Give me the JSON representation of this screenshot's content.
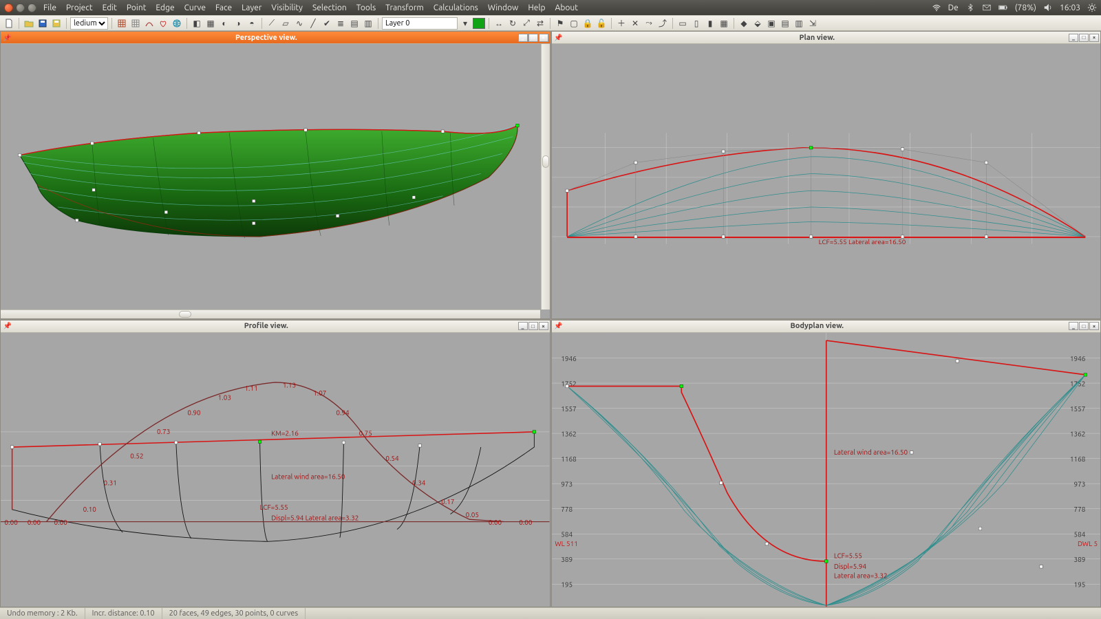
{
  "menubar": {
    "items": [
      "File",
      "Project",
      "Edit",
      "Point",
      "Edge",
      "Curve",
      "Face",
      "Layer",
      "Visibility",
      "Selection",
      "Tools",
      "Transform",
      "Calculations",
      "Window",
      "Help",
      "About"
    ],
    "keyboard_lang": "De",
    "battery": "(78%)",
    "clock": "16:03"
  },
  "toolbar": {
    "select_value": "ledium",
    "layer_value": "Layer 0",
    "swatch_color": "#10a314"
  },
  "panels": [
    {
      "title": "Perspective view.",
      "active": true,
      "has_h_scroll": true,
      "has_v_scroll": true
    },
    {
      "title": "Plan view.",
      "active": false,
      "has_h_scroll": false,
      "has_v_scroll": false
    },
    {
      "title": "Profile view.",
      "active": false,
      "has_h_scroll": false,
      "has_v_scroll": false
    },
    {
      "title": "Bodyplan view.",
      "active": false,
      "has_h_scroll": false,
      "has_v_scroll": false
    }
  ],
  "plan": {
    "annotation": "LCF=5.55 Lateral area=16.50"
  },
  "profile": {
    "km_label": "KM=2.16",
    "lat_label": "Lateral wind area=16.50",
    "lcf_label": "LCF=5.55",
    "displ_label": "Displ=5.94  Lateral area=3.32",
    "curve_values": [
      "0.10",
      "0.31",
      "0.52",
      "0.73",
      "0.90",
      "1.03",
      "1.11",
      "1.13",
      "1.07",
      "0.94",
      "0.75",
      "0.54",
      "0.34",
      "0.17",
      "0.05"
    ],
    "baseline_zeros": "0.00"
  },
  "bodyplan": {
    "ticks": [
      "195",
      "389",
      "584",
      "778",
      "973",
      "1168",
      "1362",
      "1557",
      "1752",
      "1946"
    ],
    "dwl_left": "WL 511",
    "dwl_right": "DWL 5",
    "lat_label": "Lateral wind area=16.50",
    "lcf_label": "LCF=5.55",
    "displ_label": "Displ=5.94",
    "area_label": "Lateral area=3.32"
  },
  "status": {
    "undo": "Undo memory : 2 Kb.",
    "incr": "Incr. distance: 0.10",
    "counts": "20 faces, 49 edges, 30 points, 0 curves"
  }
}
